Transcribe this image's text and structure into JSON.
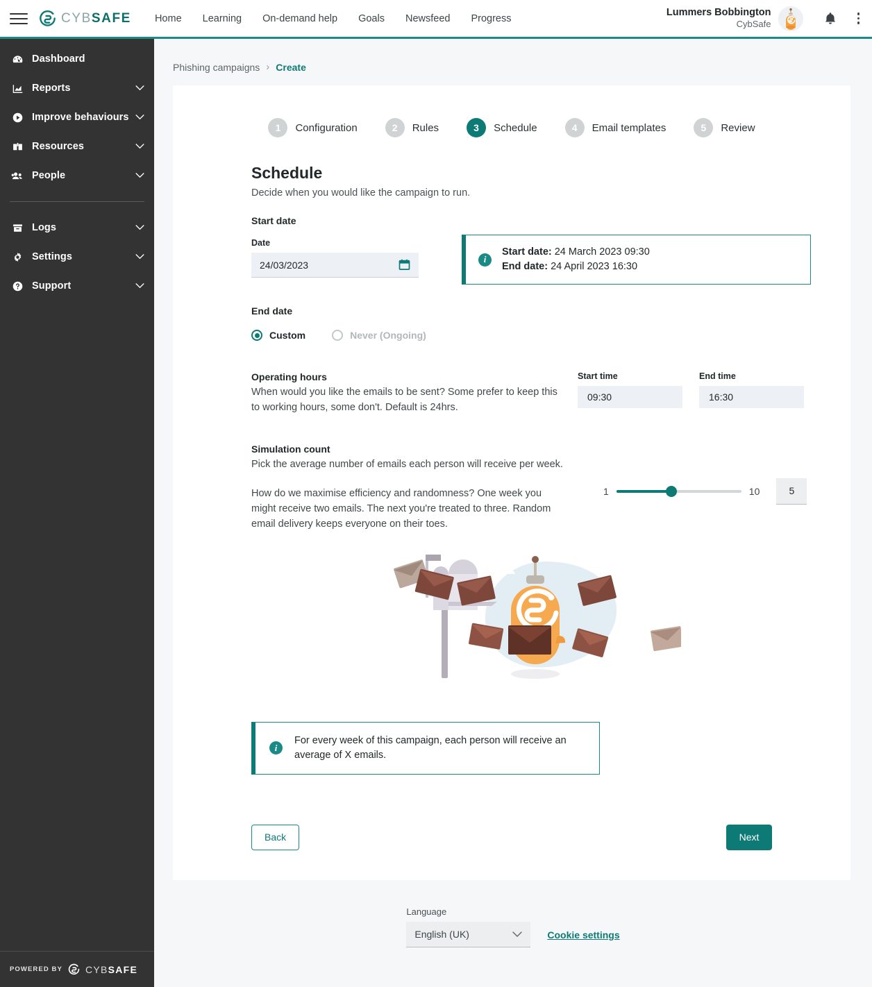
{
  "topbar": {
    "menu_icon": "hamburger-icon",
    "brand_light": "CYB",
    "brand_bold": "SAFE",
    "nav": [
      {
        "label": "Home"
      },
      {
        "label": "Learning"
      },
      {
        "label": "On-demand help"
      },
      {
        "label": "Goals"
      },
      {
        "label": "Newsfeed"
      },
      {
        "label": "Progress"
      }
    ],
    "user_name": "Lummers Bobbington",
    "user_org": "CybSafe",
    "bell_icon": "bell-icon",
    "kebab_icon": "more-vertical-icon"
  },
  "sidebar": {
    "items": [
      {
        "label": "Dashboard",
        "icon": "gauge-icon",
        "expandable": false
      },
      {
        "label": "Reports",
        "icon": "chart-icon",
        "expandable": true
      },
      {
        "label": "Improve behaviours",
        "icon": "play-circle-icon",
        "expandable": true
      },
      {
        "label": "Resources",
        "icon": "book-icon",
        "expandable": true
      },
      {
        "label": "People",
        "icon": "people-icon",
        "expandable": true
      }
    ],
    "items_lower": [
      {
        "label": "Logs",
        "icon": "archive-icon",
        "expandable": true
      },
      {
        "label": "Settings",
        "icon": "gear-icon",
        "expandable": true
      },
      {
        "label": "Support",
        "icon": "help-circle-icon",
        "expandable": true
      }
    ],
    "powered_by": "POWERED BY",
    "powered_light": "CYB",
    "powered_bold": "SAFE"
  },
  "breadcrumb": {
    "root": "Phishing campaigns",
    "separator": "›",
    "current": "Create"
  },
  "stepper": {
    "steps": [
      {
        "num": "1",
        "label": "Configuration",
        "active": false
      },
      {
        "num": "2",
        "label": "Rules",
        "active": false
      },
      {
        "num": "3",
        "label": "Schedule",
        "active": true
      },
      {
        "num": "4",
        "label": "Email templates",
        "active": false
      },
      {
        "num": "5",
        "label": "Review",
        "active": false
      }
    ]
  },
  "page": {
    "title": "Schedule",
    "subtitle": "Decide when you would like the campaign to run.",
    "start_date_heading": "Start date",
    "date_label": "Date",
    "date_value": "24/03/2023",
    "calendar_icon": "calendar-icon",
    "summary": {
      "start_label": "Start date:",
      "start_value": " 24 March 2023 09:30",
      "end_label": "End date:",
      "end_value": " 24 April 2023 16:30",
      "info_icon": "info-icon"
    },
    "end_date_heading": "End date",
    "end_date_options": [
      {
        "label": "Custom",
        "selected": true,
        "disabled": false
      },
      {
        "label": "Never (Ongoing)",
        "selected": false,
        "disabled": true
      }
    ],
    "operating_hours": {
      "title": "Operating hours",
      "body": "When would you like the emails to be sent? Some prefer to keep this to working hours, some don't. Default is 24hrs.",
      "start_time_label": "Start time",
      "start_time_value": "09:30",
      "end_time_label": "End time",
      "end_time_value": "16:30"
    },
    "simulation_count": {
      "title": "Simulation count",
      "body": "Pick the average number of emails each person will receive per week.",
      "body2": "How do we maximise efficiency and randomness? One week you might receive two emails. The next you're treated to three. Random email delivery keeps everyone on their toes.",
      "min": "1",
      "max": "10",
      "value": "5",
      "percent": 44
    },
    "illustration": "mailbox-robot-illustration",
    "note": {
      "text": "For every week of this campaign, each person will receive an average of X emails.",
      "info_icon": "info-icon"
    },
    "back_button": "Back",
    "next_button": "Next"
  },
  "footer": {
    "language_label": "Language",
    "language_value": "English (UK)",
    "chevron_icon": "chevron-down-icon",
    "cookie_link": "Cookie settings"
  },
  "colors": {
    "accent": "#0d7a76",
    "accent_light": "#1a8a87",
    "sidebar_bg": "#333333",
    "page_bg": "#f6f7f8",
    "input_bg": "#edf0f5",
    "muted": "#b2b8ba"
  }
}
